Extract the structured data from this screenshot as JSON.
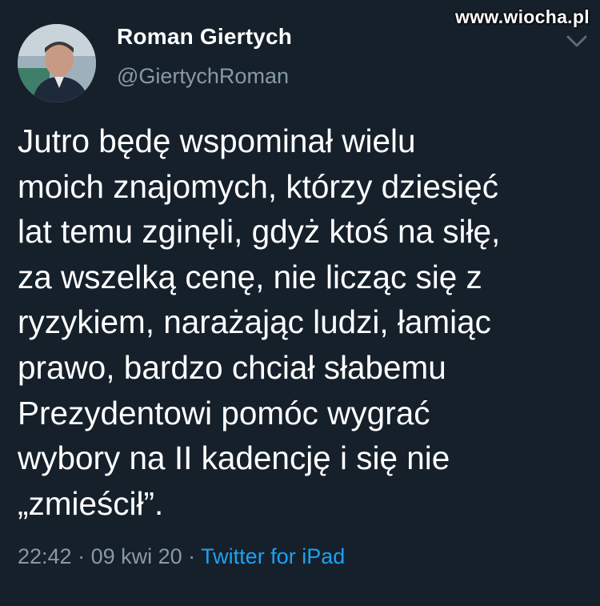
{
  "watermark": "www.wiocha.pl",
  "user": {
    "display_name": "Roman Giertych",
    "handle": "@GiertychRoman",
    "avatar_icon": "profile-photo"
  },
  "tweet": {
    "lines": [
      "Jutro będę wspominał wielu",
      "moich znajomych, którzy dziesięć",
      "lat temu zginęli, gdyż ktoś na siłę,",
      "za wszelką cenę, nie licząc się z",
      "ryzykiem, narażając ludzi, łamiąc",
      "prawo, bardzo chciał słabemu",
      "Prezydentowi pomóc wygrać",
      "wybory na II kadencję i się nie",
      "„zmieścił”."
    ]
  },
  "meta": {
    "time": "22:42",
    "separator": " · ",
    "date": "09 kwi 20",
    "source": "Twitter for iPad"
  },
  "colors": {
    "background": "#15202b",
    "text": "#ffffff",
    "secondary": "#8899a6",
    "link": "#1da1f2"
  }
}
